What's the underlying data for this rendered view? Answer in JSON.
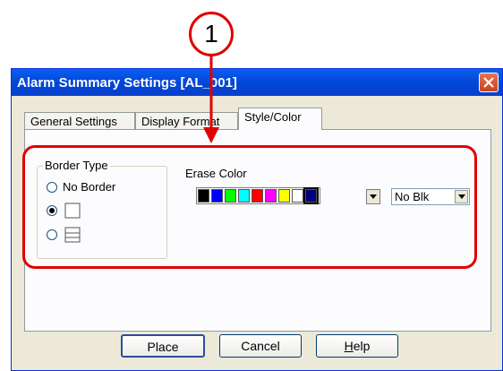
{
  "callout": {
    "number": "1"
  },
  "window": {
    "title": "Alarm Summary Settings [AL_001]",
    "close_label": "✕"
  },
  "tabs": [
    {
      "label": "General Settings",
      "active": false
    },
    {
      "label": "Display Format",
      "active": false
    },
    {
      "label": "Style/Color",
      "active": true
    }
  ],
  "border_type": {
    "legend": "Border Type",
    "options": [
      {
        "label": "No Border",
        "checked": false
      },
      {
        "label": "",
        "checked": true,
        "icon": "single-border-icon"
      },
      {
        "label": "",
        "checked": false,
        "icon": "lined-border-icon"
      }
    ]
  },
  "erase_color": {
    "label": "Erase Color",
    "swatches": [
      "#000000",
      "#0000ff",
      "#00ff00",
      "#00ffff",
      "#ff0000",
      "#ff00ff",
      "#ffff00",
      "#ffffff",
      "#000080"
    ],
    "selected_index": 8,
    "blink_value": "No Blk"
  },
  "buttons": {
    "place": "Place",
    "cancel": "Cancel",
    "help_prefix": "H",
    "help_rest": "elp"
  }
}
